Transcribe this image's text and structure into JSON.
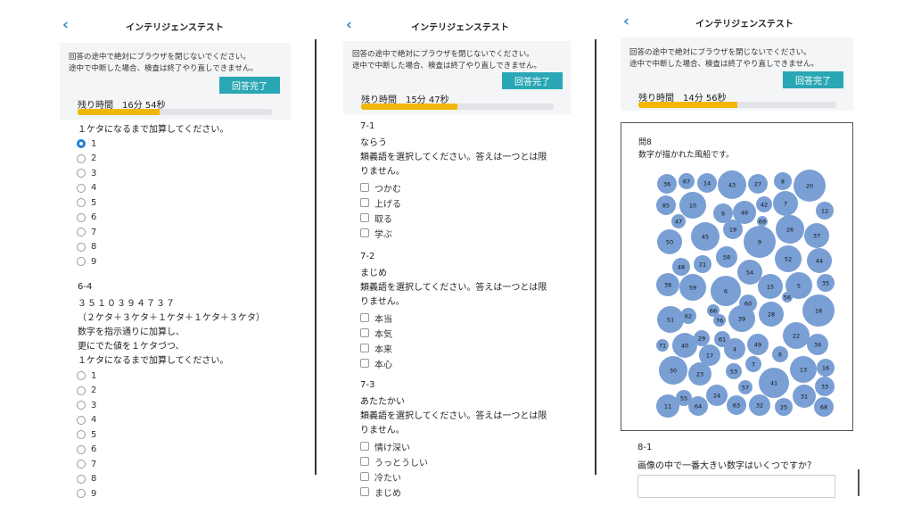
{
  "title": "インテリジェンステスト",
  "notice": [
    "回答の途中で絶対にブラウザを閉じないでください。",
    "途中で中断した場合、検査は終了やり直しできません。"
  ],
  "finish_label": "回答完了",
  "panels": [
    {
      "timer": "残り時間　16分 54秒",
      "progress": 0.42,
      "q1_instruction": "１ケタになるまで加算してください。",
      "q1_options": [
        "1",
        "2",
        "3",
        "4",
        "5",
        "6",
        "7",
        "8",
        "9"
      ],
      "q1_selected": 0,
      "q2_id": "6-4",
      "q2_digits": "３５１０３９４７３７",
      "q2_pattern": "（２ケタ＋３ケタ＋１ケタ＋１ケタ＋３ケタ）",
      "q2_lines": [
        "数字を指示通りに加算し、",
        "更にでた値を１ケタづつ、",
        "１ケタになるまで加算してください。"
      ],
      "q2_options": [
        "1",
        "2",
        "3",
        "4",
        "5",
        "6",
        "7",
        "8",
        "9"
      ]
    },
    {
      "timer": "残り時間　15分 47秒",
      "progress": 0.5,
      "questions": [
        {
          "id": "7-1",
          "word": "ならう",
          "line1": "類義語を選択してください。答えは一つとは限",
          "line2": "りません。",
          "options": [
            "つかむ",
            "上げる",
            "取る",
            "学ぶ"
          ]
        },
        {
          "id": "7-2",
          "word": "まじめ",
          "line1": "類義語を選択してください。答えは一つとは限",
          "line2": "りません。",
          "options": [
            "本当",
            "本気",
            "本来",
            "本心"
          ]
        },
        {
          "id": "7-3",
          "word": "あたたかい",
          "line1": "類義語を選択してください。答えは一つとは限",
          "line2": "りません。",
          "options": [
            "情け深い",
            "うっとうしい",
            "冷たい",
            "まじめ"
          ]
        }
      ]
    },
    {
      "timer": "残り時間　14分 56秒",
      "progress": 0.5,
      "figure_title": "問8",
      "figure_caption": "数字が描かれた風船です。",
      "balloon_color": "#7a9fd4",
      "balloons": [
        "36",
        "67",
        "14",
        "43",
        "27",
        "8",
        "20",
        "85",
        "10",
        "42",
        "7",
        "12",
        "47",
        "9",
        "46",
        "69",
        "26",
        "50",
        "45",
        "19",
        "9",
        "37",
        "48",
        "21",
        "58",
        "52",
        "44",
        "54",
        "38",
        "59",
        "6",
        "15",
        "5",
        "35",
        "60",
        "56",
        "66",
        "51",
        "62",
        "76",
        "39",
        "28",
        "18",
        "29",
        "61",
        "71",
        "40",
        "17",
        "4",
        "49",
        "22",
        "34",
        "30",
        "23",
        "53",
        "7",
        "6",
        "13",
        "16",
        "55",
        "24",
        "57",
        "41",
        "33",
        "31",
        "11",
        "64",
        "63",
        "32",
        "25",
        "68"
      ],
      "q_id": "8-1",
      "q_text": "画像の中で一番大きい数字はいくつですか？"
    }
  ]
}
